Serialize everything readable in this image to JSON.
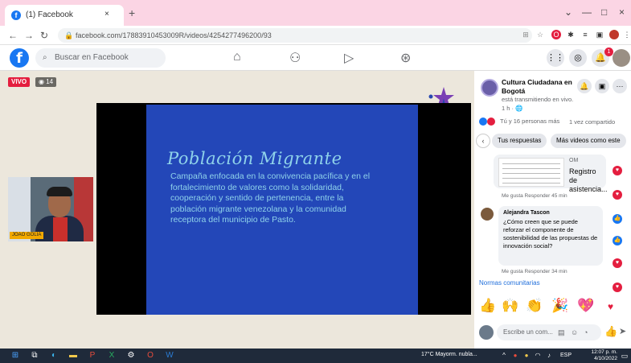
{
  "browser": {
    "tab_title": "(1) Facebook",
    "tab_close": "×",
    "new_tab": "+",
    "url": "facebook.com/17883910453009R/videos/4254277496200/93",
    "window_controls": [
      "⌄",
      "—",
      "□",
      "×"
    ]
  },
  "facebook": {
    "logo": "f",
    "search_placeholder": "Buscar en Facebook",
    "nav_icons": [
      "home-icon",
      "friends-icon",
      "watch-icon",
      "groups-icon"
    ],
    "header_icons": [
      "menu-icon",
      "messenger-icon",
      "notifications-icon",
      "profile-icon"
    ],
    "notification_count": "1"
  },
  "video": {
    "live_badge": "VIVO",
    "viewer_count": "◉ 14",
    "slide_title": "Población Migrante",
    "slide_body": "Campaña enfocada en la convivencia pacífica y en el fortalecimiento de valores como la solidaridad, cooperación y sentido de pertenencia, entre la población migrante venezolana y la comunidad receptora del municipio de Pasto.",
    "webcam_nametag": "JOAO GOLIA"
  },
  "panel": {
    "page_name": "Cultura Ciudadana en Bogotá",
    "page_meta": "está transmitiendo en vivo.",
    "page_time": "1 h · 🌐",
    "reactions_text": "Tú y 16 personas más",
    "shares_text": "1 vez compartido",
    "chip_responses": "Tus respuestas",
    "chip_more_videos": "Más videos como este",
    "comment1": {
      "sender": "OM",
      "text": "Registro de asistencia...",
      "actions": "Me gusta   Responder   45 min"
    },
    "comment2": {
      "name": "Alejandra Tascon",
      "text": "¿Cómo creen que se puede reforzar el componente de sostenibilidad de las propuestas de innovación social?",
      "actions": "Me gusta   Responder   34 min"
    },
    "norms_link": "Normas comunitarias",
    "composer_placeholder": "Escribe un com..."
  },
  "taskbar": {
    "weather": "17°C  Mayorm. nubla...",
    "time": "12:07 p. m.",
    "date": "4/10/2022",
    "lang": "ESP"
  }
}
